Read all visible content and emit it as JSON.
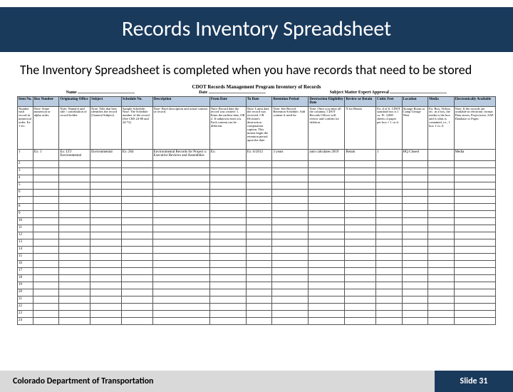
{
  "header": {
    "title": "Records Inventory Spreadsheet"
  },
  "body": {
    "text": "The Inventory Spreadsheet is completed when you have records that need to be stored"
  },
  "sheet": {
    "title": "CDOT Records Management Program Inventory of Records",
    "meta": {
      "name_label": "Name",
      "date_label": "Date",
      "sme_label": "Subject Matter Expert Approval"
    },
    "columns": [
      "Item No.",
      "Box Number",
      "Originating Office",
      "Subject",
      "Schedule No.",
      "Description",
      "From Date",
      "To Date",
      "Retention Period",
      "Destruction Eligibility Date",
      "Review or Retain",
      "Cubic Feet",
      "Location",
      "Media",
      "Electronically Available"
    ],
    "guide": [
      "Number each record in numerical order. Ex: 1 etc.",
      "Note: Some numerical or alpha order.",
      "Note: Name(s) and title / contribution of record holder.",
      "Note: Title that best identifies the record (General Subject).",
      "Sample Schedule: Note: The Schedule number of the record (See CRS 24-80 and 24-72)",
      "Note: Brief description and actual content of record.",
      "Note: Record date the record was created: 1. Enter the earliest date, OR 2. If unknown enter n/a. Each content can be different.",
      "Note: Latest date the record was received. CR Division's destruction computation caption. This means begin the retention period upon the date.",
      "Note: See Record Retention Schedule. Add content if need be.",
      "Note: Once you enter all the columns, CDOT Records Officer will review and confirm for deletion.",
      "N for Retain",
      "Ex: # of ft. CDOT standard box is 1 cu. Ft. 3,000 sheets of paper per box = 1 cu ft",
      "Storage Room at Camp George West",
      "Ex: Box, Videos, etc. in a box, the media is the box and is what is contained, i.e., 1 box 1 cu. ft",
      "Note: If the records are available in electronic format: Data stores, Projectwise, SAP Database or Paper."
    ],
    "rows": [
      [
        "1",
        "Ex: 1",
        "Ex: LTJ Environmental",
        "Environmental",
        "Ex: 264",
        "Environmental Records for Project x: Executive Reviews and Assemblies",
        "Ex:",
        "Ex: 6/2012",
        "3 years",
        "auto calculates 2019",
        "Retain",
        "1",
        "HQ Closed",
        "",
        "Media"
      ]
    ]
  },
  "footer": {
    "org": "Colorado Department of Transportation",
    "slide": "Slide 31"
  }
}
